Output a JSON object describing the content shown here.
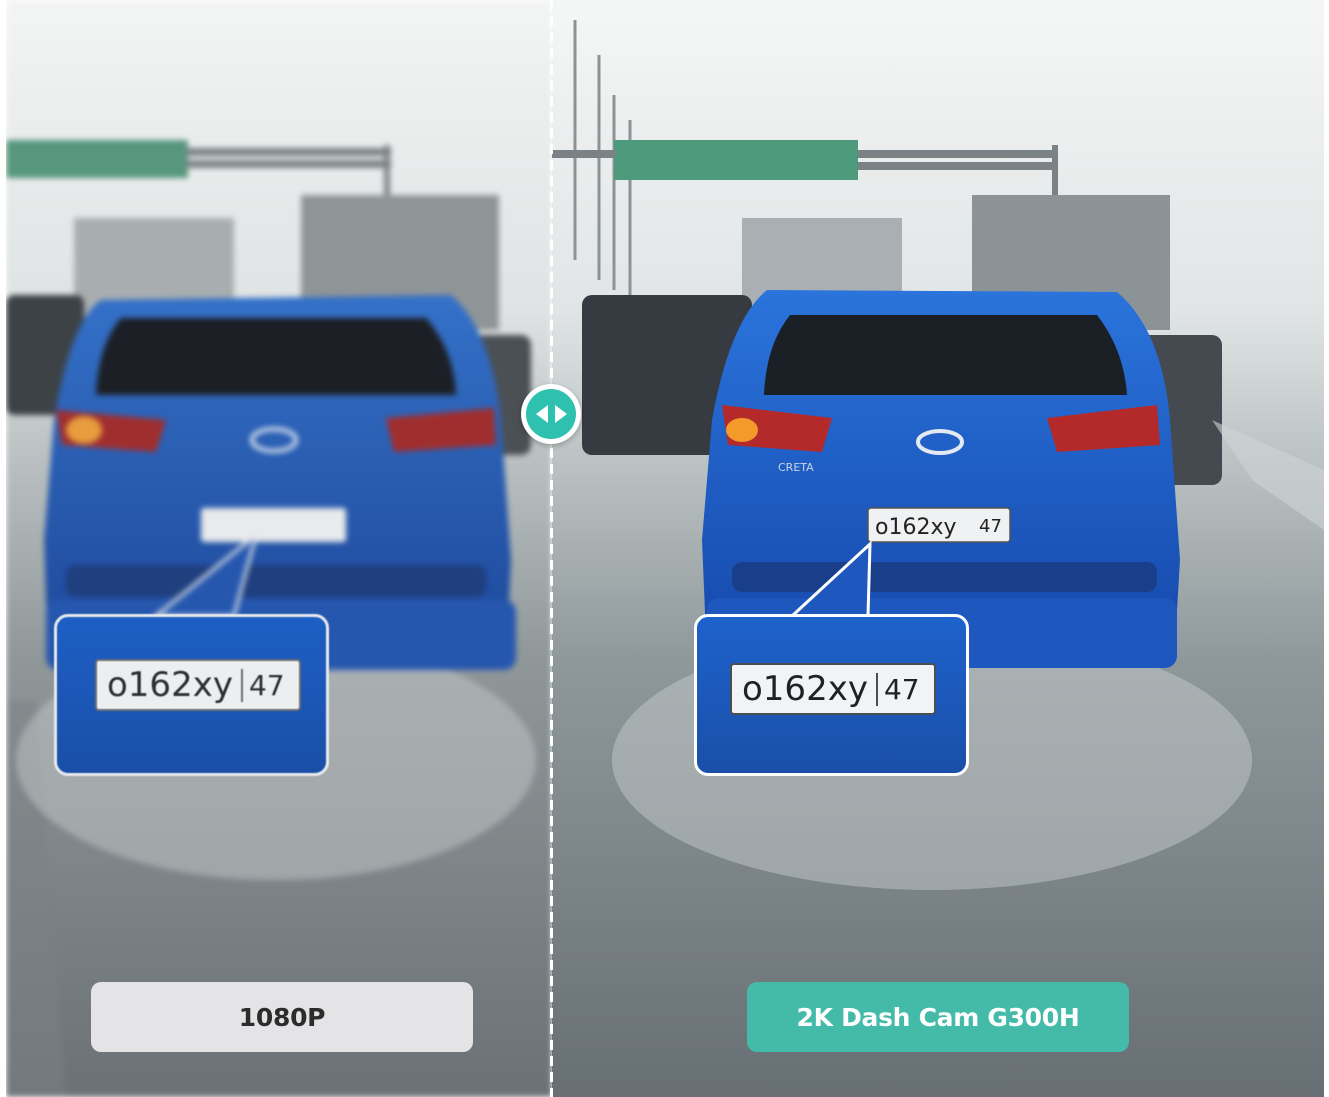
{
  "comparison": {
    "left": {
      "label": "1080P",
      "plate_text": "о162ху",
      "plate_region": "47"
    },
    "right": {
      "label": "2K Dash Cam G300H",
      "plate_text": "о162ху",
      "plate_region": "47"
    }
  },
  "car_badge": "CRETA",
  "colors": {
    "accent": "#43bba8",
    "handle": "#2fc1b0",
    "car_blue": "#1f63cc"
  },
  "icons": [
    "compare-arrows-icon",
    "hyundai-logo"
  ]
}
